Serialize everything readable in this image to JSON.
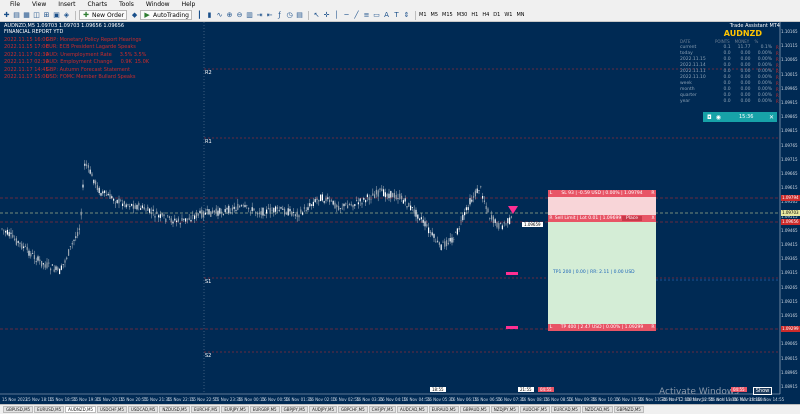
{
  "menu": [
    "File",
    "View",
    "Insert",
    "Charts",
    "Tools",
    "Window",
    "Help"
  ],
  "toolbar": {
    "new_order": "New Order",
    "autotrading": "AutoTrading",
    "timeframes": [
      "M1",
      "M5",
      "M15",
      "M30",
      "H1",
      "H4",
      "D1",
      "W1",
      "MN"
    ]
  },
  "chart": {
    "symbol_line": "AUDNZD,M5 1.09703 1.09703 1.09656 1.09656",
    "report_title": "FINANCIAL REPORT YTD",
    "news": [
      {
        "date": "2022.11.15 16:00",
        "text": "GBP: Monetary Policy Report Hearings",
        "v1": "",
        "v2": ""
      },
      {
        "date": "2022.11.15 17:00",
        "text": "EUR: ECB President Lagarde Speaks",
        "v1": "",
        "v2": ""
      },
      {
        "date": "2022.11.17 02:30",
        "text": "AUD: Unemployment Rate",
        "v1": "3.5%",
        "v2": "3.5%"
      },
      {
        "date": "2022.11.17 02:30",
        "text": "AUD: Employment Change",
        "v1": "0.9K",
        "v2": "15.0K"
      },
      {
        "date": "2022.11.17 14:45",
        "text": "GBP: Autumn Forecast Statement",
        "v1": "",
        "v2": ""
      },
      {
        "date": "2022.11.17 15:00",
        "text": "USD: FOMC Member Bullard Speaks",
        "v1": "",
        "v2": ""
      }
    ],
    "levels": {
      "r2": "R2",
      "r1": "R1",
      "s1": "S1",
      "s2": "S2"
    }
  },
  "assistant": {
    "header": "Trade Assistant MT4",
    "symbol": "AUDNZD",
    "columns": [
      "DATE",
      "POINTS",
      "MONEY",
      "%"
    ],
    "rows": [
      {
        "label": "current",
        "points": "0.1",
        "money": "11.77",
        "pct": "0.1%"
      },
      {
        "label": "today",
        "points": "0.0",
        "money": "0.00",
        "pct": "0.00%"
      },
      {
        "label": "2022.11.15",
        "points": "0.0",
        "money": "0.00",
        "pct": "0.00%"
      },
      {
        "label": "2022.11.14",
        "points": "0.0",
        "money": "0.00",
        "pct": "0.00%"
      },
      {
        "label": "2022.11.11",
        "points": "0.0",
        "money": "0.00",
        "pct": "0.00%"
      },
      {
        "label": "2022.11.10",
        "points": "0.0",
        "money": "0.00",
        "pct": "0.00%"
      },
      {
        "label": "week",
        "points": "0.0",
        "money": "0.00",
        "pct": "0.00%"
      },
      {
        "label": "month",
        "points": "0.0",
        "money": "0.00",
        "pct": "0.00%"
      },
      {
        "label": "quarter",
        "points": "0.0",
        "money": "0.00",
        "pct": "0.00%"
      },
      {
        "label": "year",
        "points": "0.0",
        "money": "0.00",
        "pct": "0.00%"
      }
    ],
    "reset": "R"
  },
  "timer": {
    "time": "15:36"
  },
  "trade": {
    "sl": "SL 93 | -0.59 USD | 0.00% | 1.09794",
    "entry": "Sell Limit | Lot 0.01 | 1.09699",
    "place": "Place",
    "close": "X",
    "tp1": "TP1 200 | 0.00 | RR: 2.11 | 0.00 USD",
    "tp": "TP 400 | 2.47 USD | 0.00% | 1.09299",
    "cap_left": "L",
    "cap_right": "R"
  },
  "price_axis": [
    "1.10165",
    "1.10115",
    "1.10065",
    "1.10015",
    "1.09965",
    "1.09915",
    "1.09865",
    "1.09815",
    "1.09765",
    "1.09715",
    "1.09665",
    "1.09615",
    "1.09565",
    "1.09515",
    "1.09465",
    "1.09415",
    "1.09365",
    "1.09315",
    "1.09265",
    "1.09215",
    "1.09165",
    "1.09115",
    "1.09065",
    "1.09015",
    "1.08965",
    "1.08915"
  ],
  "price_tags": {
    "sl": "1.09794",
    "ask": "1.09703",
    "bid": "1.09656",
    "tp": "1.09299",
    "cursor": "1.09659"
  },
  "time_axis": [
    "15 Nov 2022",
    "15 Nov 18:15",
    "15 Nov 18:55",
    "15 Nov 19:35",
    "15 Nov 20:15",
    "15 Nov 20:55",
    "15 Nov 21:35",
    "15 Nov 22:15",
    "15 Nov 22:55",
    "15 Nov 23:35",
    "16 Nov 00:15",
    "16 Nov 00:55",
    "16 Nov 01:35",
    "16 Nov 02:15",
    "16 Nov 02:55",
    "16 Nov 03:35",
    "16 Nov 04:15",
    "16 Nov 04:55",
    "16 Nov 05:35",
    "16 Nov 06:15",
    "16 Nov 06:55",
    "16 Nov 07:35",
    "16 Nov 08:15",
    "16 Nov 08:55",
    "16 Nov 09:35",
    "16 Nov 10:15",
    "16 Nov 10:55",
    "16 Nov 11:35",
    "16 Nov 12:15",
    "16 Nov 12:55",
    "16 Nov 13:35",
    "16 Nov 14:15",
    "16 Nov 14:55"
  ],
  "time_markers": {
    "a": "18:55",
    "b": "21:55",
    "c": "04:55"
  },
  "watermark": {
    "title": "Activate Windows",
    "sub": "Go to PC settings to activate Windows.",
    "show": "Show"
  },
  "tabs": [
    "GBPUSD,M5",
    "EURUSD,M5",
    "AUDNZD,M5",
    "USDCHF,M5",
    "USDCAD,M5",
    "NZDUSD,M5",
    "EURCHF,M5",
    "EURJPY,M5",
    "EURGBP,M5",
    "GBPJPY,M5",
    "AUDJPY,M5",
    "GBPCHF,M5",
    "CHFJPY,M5",
    "AUDCAD,M5",
    "EURAUD,M5",
    "GBPAUD,M5",
    "NZDJPY,M5",
    "AUDCHF,M5",
    "EURCAD,M5",
    "NZDCAD,M5",
    "GBPNZD,M5"
  ],
  "colors": {
    "bg": "#002a54",
    "candle": "#e8e8e8",
    "level": "#cc2b2b",
    "accent": "#ff2f92"
  }
}
